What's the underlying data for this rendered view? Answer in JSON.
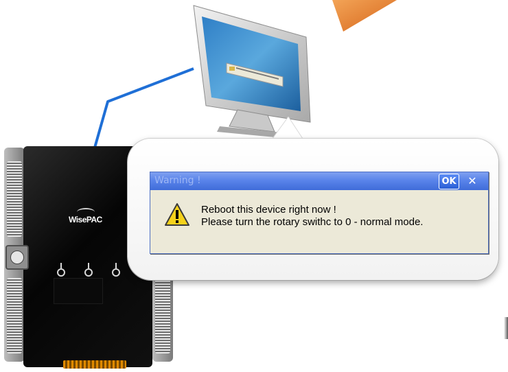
{
  "dialog": {
    "title": "Warning !",
    "ok_label": "OK",
    "close_symbol": "✕",
    "message_line1": "Reboot this device right now !",
    "message_line2": "Please turn the rotary swithc to 0 - normal mode.",
    "icon": "warning-icon"
  },
  "device": {
    "brand_label": "WisePAC"
  },
  "colors": {
    "titlebar": "#3f6cd9",
    "dialog_background": "#ece9d8",
    "arrow": "#e07a2a",
    "cable": "#1f6fd6"
  },
  "icons": [
    "warning-icon",
    "close-icon",
    "orange-arrow-icon",
    "monitor-icon",
    "rotary-switch-icon",
    "led-icon"
  ]
}
